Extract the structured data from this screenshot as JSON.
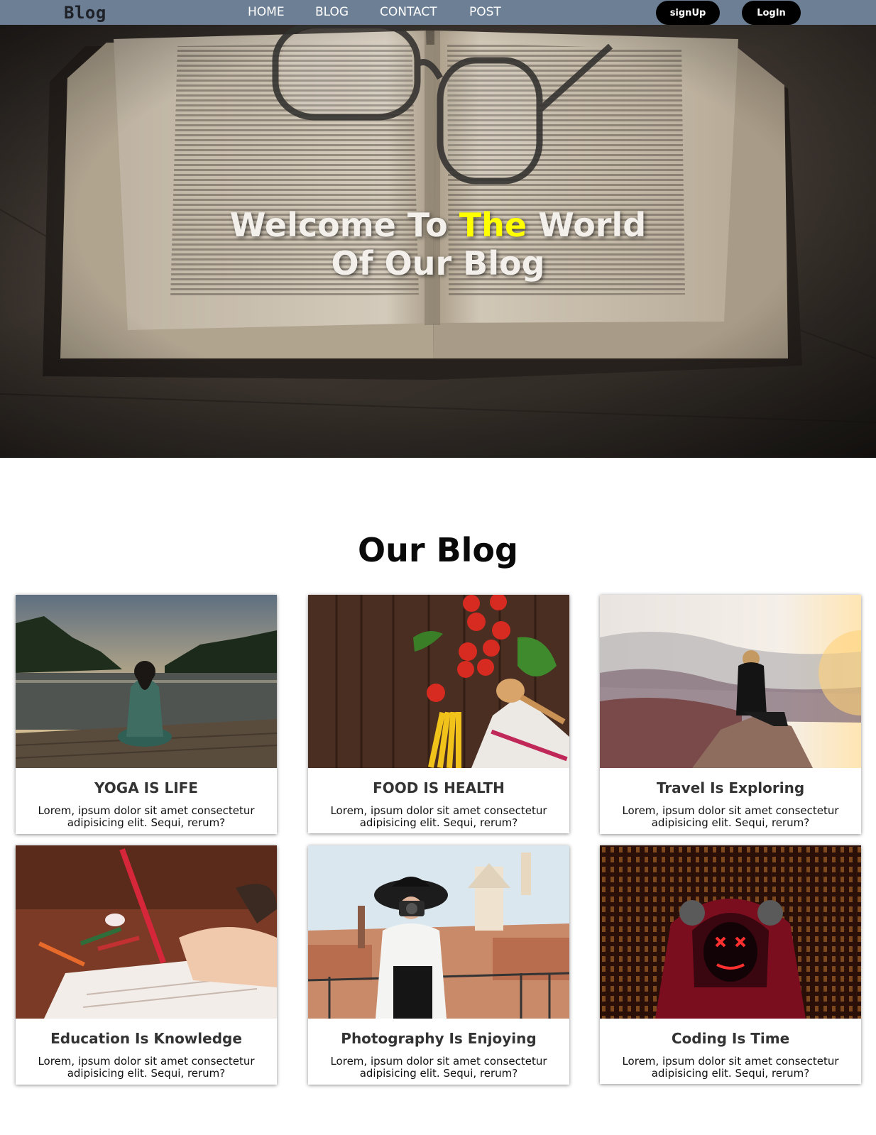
{
  "navbar": {
    "brand": "Blog",
    "links": [
      "HOME",
      "BLOG",
      "CONTACT",
      "POST"
    ],
    "signup_label": "signUp",
    "login_label": "LogIn"
  },
  "hero": {
    "title_part1": "Welcome To ",
    "title_highlight": "The",
    "title_part2": " World",
    "title_line2": "Of Our Blog",
    "highlight_color": "#ffff00"
  },
  "section": {
    "title": "Our Blog"
  },
  "cards": [
    {
      "title": "YOGA IS LIFE",
      "description": "Lorem, ipsum dolor sit amet consectetur adipisicing elit. Sequi, rerum?"
    },
    {
      "title": "FOOD IS HEALTH",
      "description": "Lorem, ipsum dolor sit amet consectetur adipisicing elit. Sequi, rerum?"
    },
    {
      "title": "Travel Is Exploring",
      "description": "Lorem, ipsum dolor sit amet consectetur adipisicing elit. Sequi, rerum?"
    },
    {
      "title": "Education Is Knowledge",
      "description": "Lorem, ipsum dolor sit amet consectetur adipisicing elit. Sequi, rerum?"
    },
    {
      "title": "Photography Is Enjoying",
      "description": "Lorem, ipsum dolor sit amet consectetur adipisicing elit. Sequi, rerum?"
    },
    {
      "title": "Coding Is Time",
      "description": "Lorem, ipsum dolor sit amet consectetur adipisicing elit. Sequi, rerum?"
    }
  ],
  "colors": {
    "navbar_bg": "#6d7f95",
    "button_bg": "#000000",
    "hero_highlight": "#ffff00"
  }
}
